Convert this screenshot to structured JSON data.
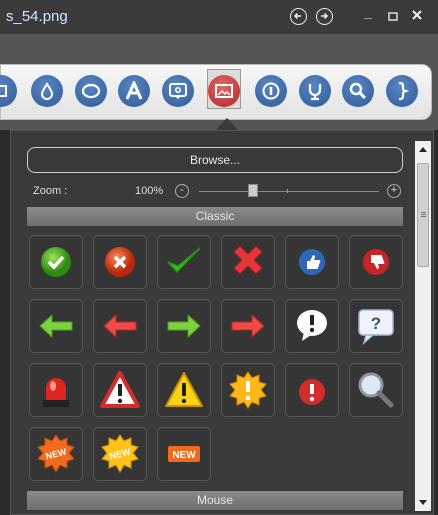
{
  "window": {
    "title": "s_54.png"
  },
  "panel": {
    "browse_label": "Browse...",
    "zoom": {
      "label": "Zoom :",
      "value": "100%",
      "minus_label": "-",
      "plus_label": "+",
      "level": 0.3
    },
    "sections": [
      {
        "title": "Classic"
      },
      {
        "title": "Mouse"
      }
    ],
    "classic_icons": [
      "green-check-circle-icon",
      "red-x-circle-icon",
      "green-checkmark-icon",
      "red-x-mark-icon",
      "thumbs-up-icon",
      "thumbs-down-icon",
      "green-left-arrow-icon",
      "red-left-arrow-icon",
      "green-right-arrow-icon",
      "red-right-arrow-icon",
      "exclamation-bubble-icon",
      "question-bubble-icon",
      "red-siren-icon",
      "red-warning-triangle-icon",
      "yellow-warning-triangle-icon",
      "yellow-exclamation-burst-icon",
      "red-exclamation-circle-icon",
      "magnifier-icon",
      "orange-new-badge-icon",
      "yellow-new-badge-icon",
      "new-label-icon"
    ],
    "new_text": "NEW"
  },
  "colors": {
    "accent": "#2f5a98",
    "background": "#2b2b2b",
    "panel": "#3a3a3a"
  }
}
